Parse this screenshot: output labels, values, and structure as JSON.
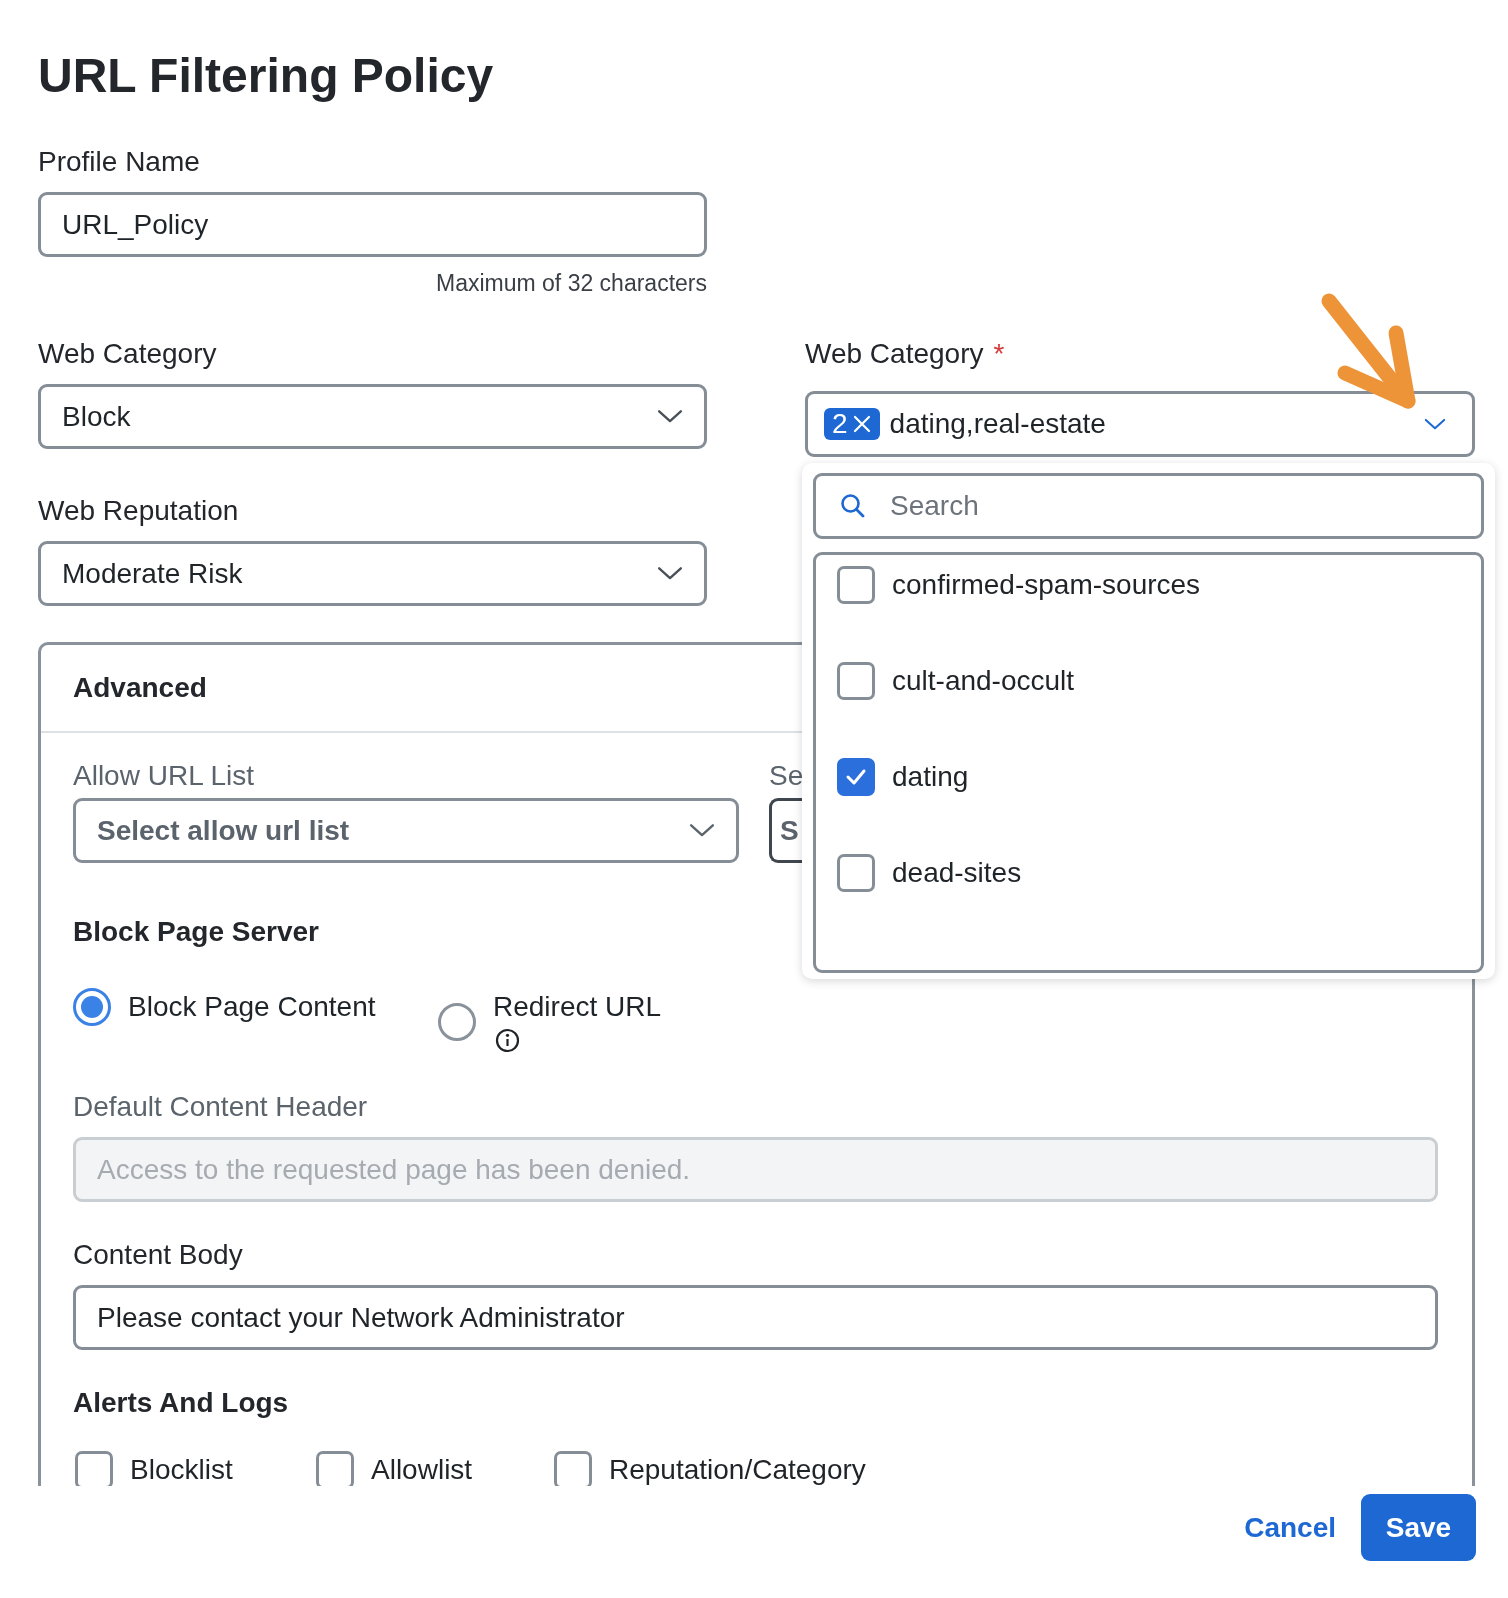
{
  "title": "URL Filtering Policy",
  "profile_name": {
    "label": "Profile Name",
    "value": "URL_Policy",
    "hint": "Maximum of 32 characters"
  },
  "web_category_action": {
    "label": "Web Category",
    "value": "Block"
  },
  "web_reputation": {
    "label": "Web Reputation",
    "value": "Moderate Risk"
  },
  "web_category": {
    "label": "Web Category",
    "required_mark": "*",
    "count": "2",
    "value": "dating,real-estate",
    "expanded": true,
    "search": {
      "placeholder": "Search"
    },
    "options": [
      {
        "label": "confirmed-spam-sources",
        "checked": false
      },
      {
        "label": "cult-and-occult",
        "checked": false
      },
      {
        "label": "dating",
        "checked": true
      },
      {
        "label": "dead-sites",
        "checked": false
      }
    ]
  },
  "advanced": {
    "title": "Advanced",
    "allow_url_list": {
      "label": "Allow URL List",
      "placeholder": "Select allow url list"
    },
    "column_2": {
      "label": "Se",
      "value": "S"
    },
    "block_page_server": {
      "title": "Block Page Server",
      "options": [
        {
          "label": "Block Page Content",
          "selected": true,
          "info": false
        },
        {
          "label": "Redirect URL",
          "selected": false,
          "info": true
        }
      ]
    },
    "default_content_header": {
      "label": "Default Content Header",
      "placeholder": "Access to the requested page has been denied.",
      "disabled": true
    },
    "content_body": {
      "label": "Content Body",
      "value": "Please contact your Network Administrator"
    },
    "alerts_and_logs": {
      "title": "Alerts And Logs",
      "options": [
        {
          "label": "Blocklist",
          "checked": false
        },
        {
          "label": "Allowlist",
          "checked": false
        },
        {
          "label": "Reputation/Category",
          "checked": false
        }
      ]
    }
  },
  "buttons": [
    {
      "label": "Cancel",
      "kind": "link"
    },
    {
      "label": "Save",
      "kind": "primary"
    }
  ]
}
